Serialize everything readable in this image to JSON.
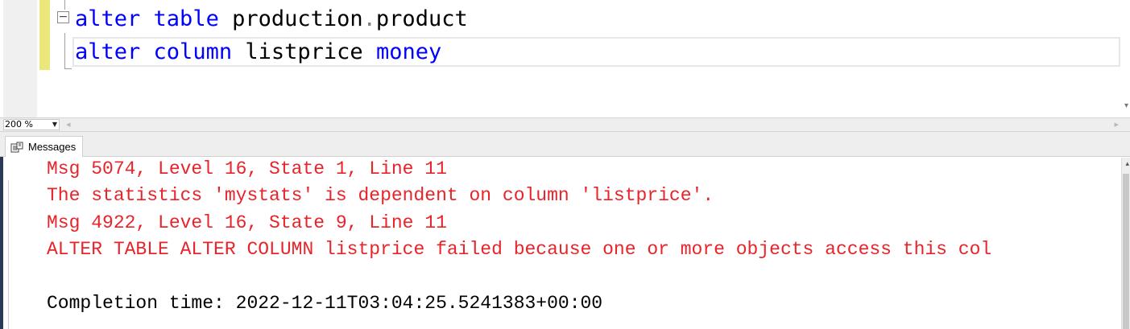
{
  "editor": {
    "line1": {
      "kw1": "alter",
      "kw2": "table",
      "schema": "production",
      "dot": ".",
      "object": "product"
    },
    "line2": {
      "kw1": "alter",
      "kw2": "column",
      "column": "listprice",
      "type": "money"
    },
    "collapse_glyph": "−"
  },
  "zoom": {
    "value": "200 %"
  },
  "results_tabs": [
    {
      "label": "Messages",
      "icon": "messages-icon"
    }
  ],
  "messages": [
    {
      "text": "Msg 5074, Level 16, State 1, Line 11",
      "kind": "error"
    },
    {
      "text": "The statistics 'mystats' is dependent on column 'listprice'.",
      "kind": "error"
    },
    {
      "text": "Msg 4922, Level 16, State 9, Line 11",
      "kind": "error"
    },
    {
      "text": "ALTER TABLE ALTER COLUMN listprice failed because one or more objects access this col",
      "kind": "error"
    },
    {
      "text": "",
      "kind": "blank"
    },
    {
      "text": "Completion time: 2022-12-11T03:04:25.5241383+00:00",
      "kind": "info"
    }
  ],
  "colors": {
    "keyword": "#0000ff",
    "error": "#e8232a",
    "change_bar": "#ece77a"
  }
}
